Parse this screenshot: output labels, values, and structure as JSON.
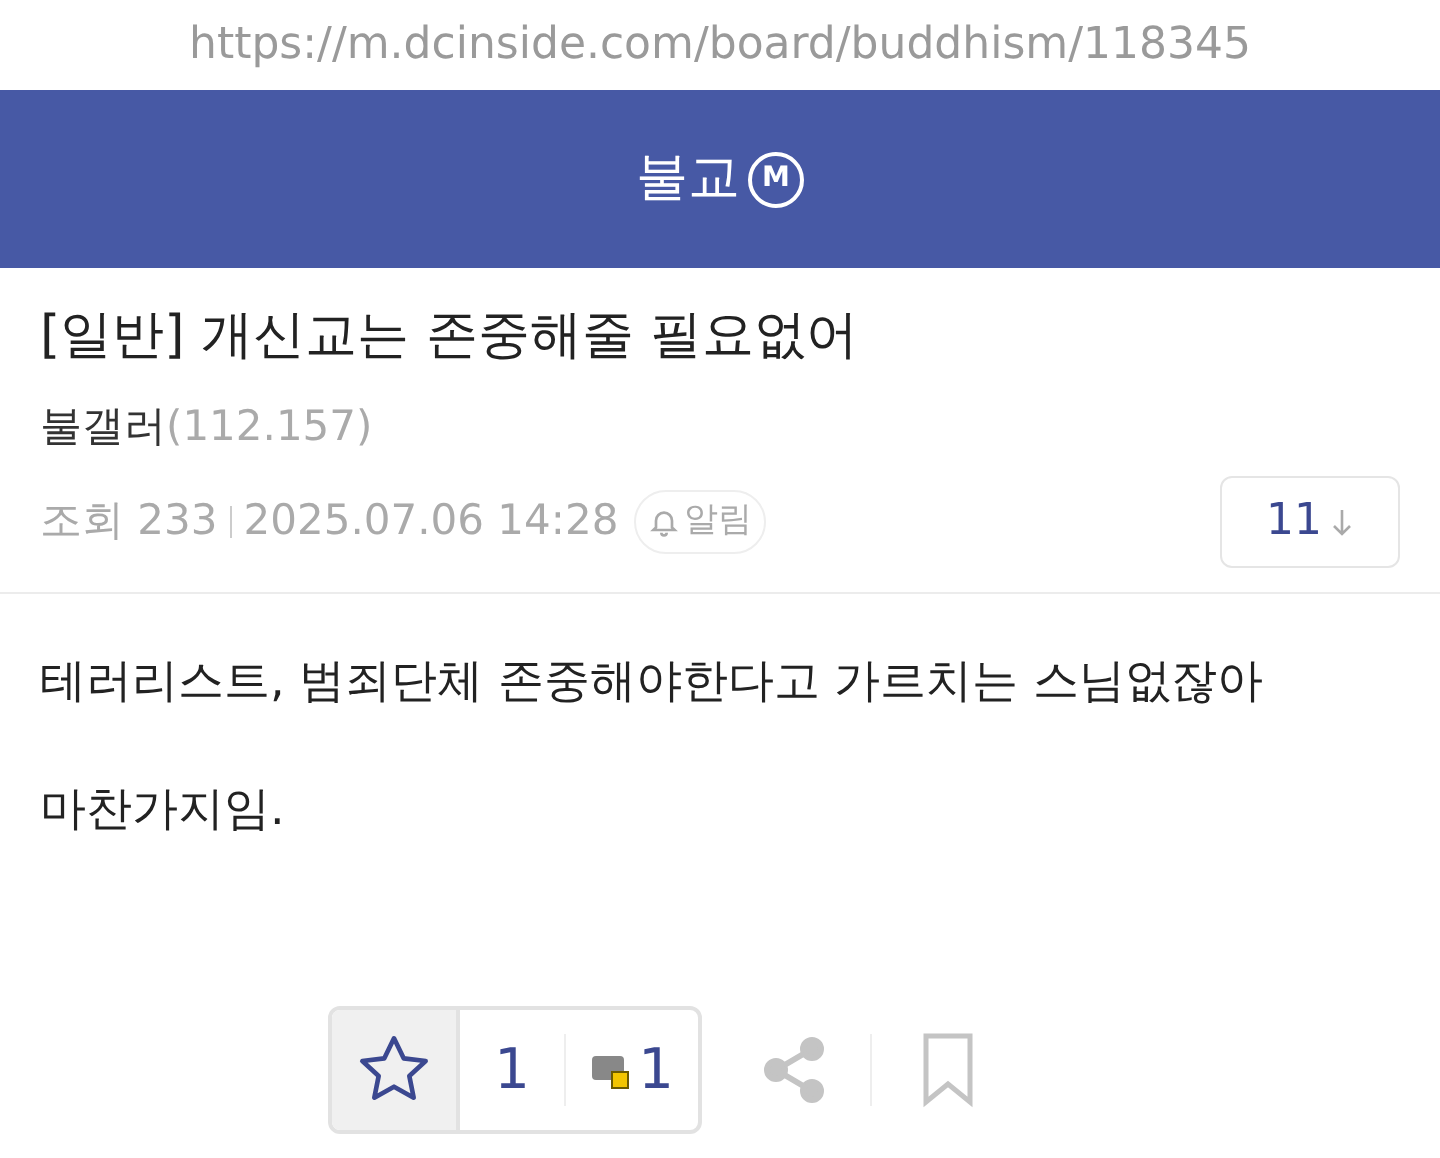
{
  "url": "https://m.dcinside.com/board/buddhism/118345",
  "header": {
    "title": "불교",
    "badge": "M"
  },
  "post": {
    "title": "[일반] 개신교는 존중해줄 필요없어",
    "author": "불갤러",
    "ip": "(112.157)",
    "views": "조회 233",
    "date": "2025.07.06 14:28",
    "alert": "알림",
    "comments": "11"
  },
  "body": [
    "테러리스트, 범죄단체 존중해야한다고 가르치는 스님없잖아",
    "마찬가지임."
  ],
  "actions": {
    "recommend": "1",
    "fixed_recommend": "1"
  }
}
